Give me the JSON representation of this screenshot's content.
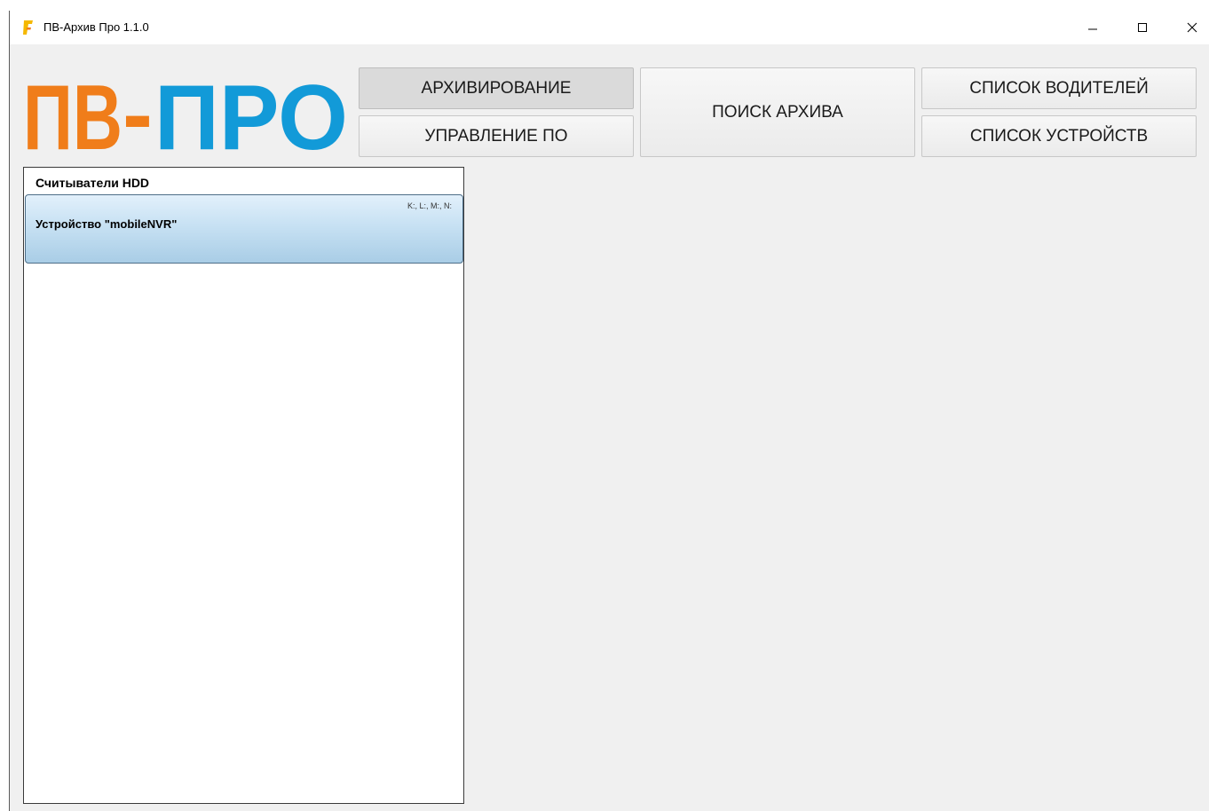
{
  "window": {
    "title": "ПВ-Архив Про 1.1.0",
    "controls": {
      "minimize_icon": "minimize-icon",
      "maximize_icon": "maximize-icon",
      "close_icon": "close-icon"
    }
  },
  "logo": {
    "part1": "ПВ",
    "dash": "-",
    "part2": "ПРО",
    "colors": {
      "orange": "#f07d1a",
      "blue": "#129ad8"
    }
  },
  "toolbar": {
    "archive_label": "АРХИВИРОВАНИЕ",
    "software_label": "УПРАВЛЕНИЕ ПО",
    "search_label": "ПОИСК АРХИВА",
    "drivers_label": "СПИСОК ВОДИТЕЛЕЙ",
    "devices_label": "СПИСОК УСТРОЙСТВ"
  },
  "readers": {
    "title": "Считыватели HDD",
    "devices": [
      {
        "name": "Устройство \"mobileNVR\"",
        "drives": "K:, L:, M:, N:"
      }
    ]
  }
}
